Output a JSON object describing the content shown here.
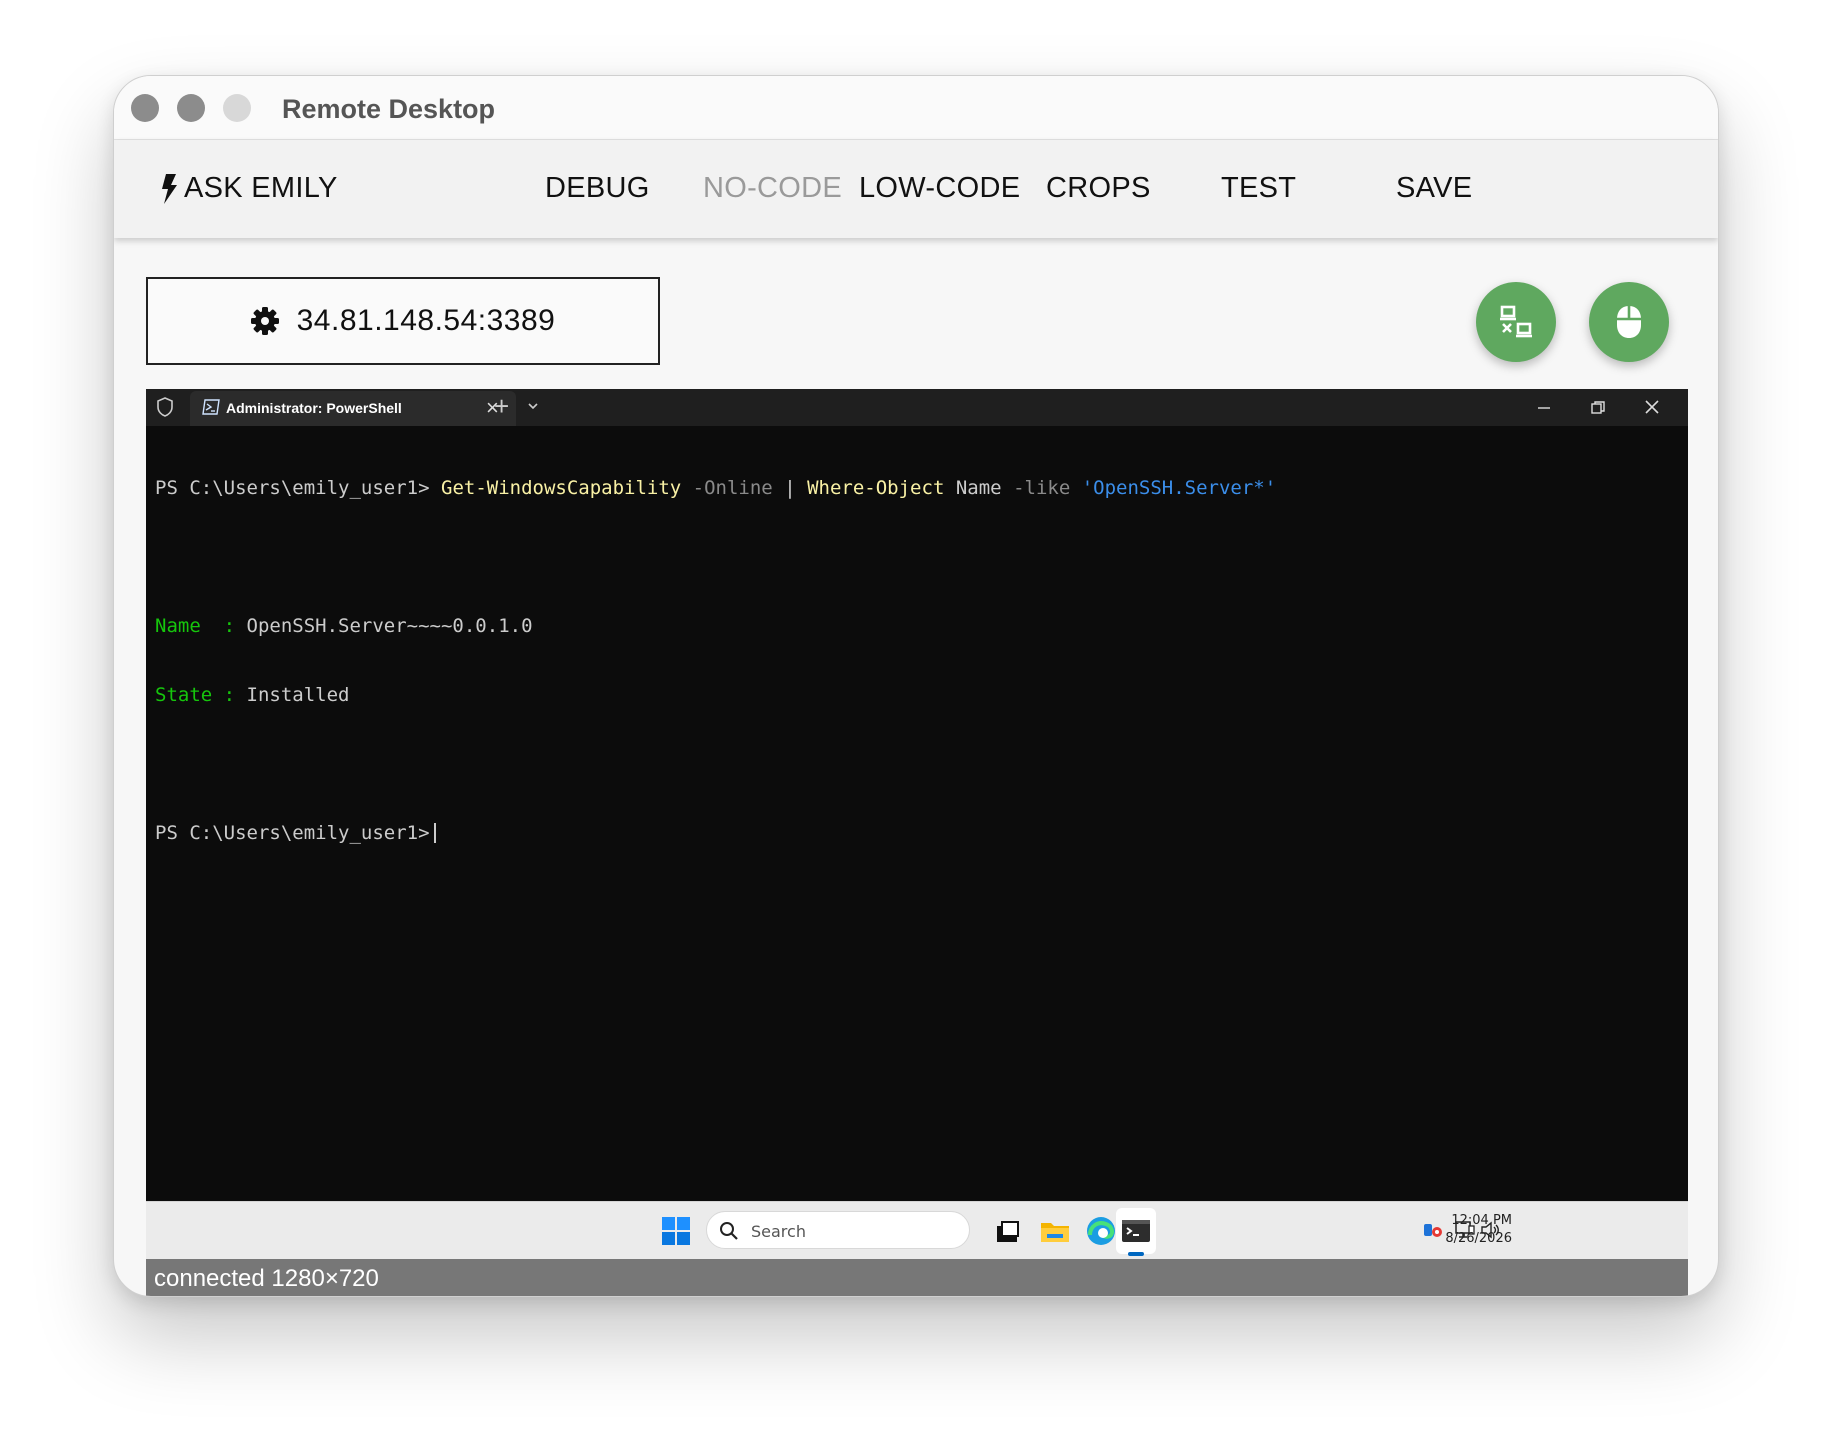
{
  "window": {
    "title": "Remote Desktop"
  },
  "toolbar": {
    "ask_label": "ASK EMILY",
    "items": [
      {
        "label": "DEBUG",
        "enabled": true
      },
      {
        "label": "NO-CODE",
        "enabled": false
      },
      {
        "label": "LOW-CODE",
        "enabled": true
      },
      {
        "label": "CROPS",
        "enabled": true
      },
      {
        "label": "TEST",
        "enabled": true
      },
      {
        "label": "SAVE",
        "enabled": true
      }
    ]
  },
  "connection": {
    "address": "34.81.148.54:3389"
  },
  "fab_color": "#5fa85f",
  "terminal": {
    "tab_title": "Administrator: PowerShell",
    "prompt": "PS C:\\Users\\emily_user1>",
    "command": {
      "cmdlet1": "Get-WindowsCapability",
      "param1": "-Online",
      "pipe": "|",
      "cmdlet2": "Where-Object",
      "arg": "Name",
      "param2": "-like",
      "string": "'OpenSSH.Server*'"
    },
    "output": [
      {
        "key": "Name ",
        "value": "OpenSSH.Server~~~~0.0.1.0"
      },
      {
        "key": "State",
        "value": "Installed"
      }
    ]
  },
  "taskbar": {
    "search_placeholder": "Search",
    "time": "12:04 PM",
    "date": "8/26/2026"
  },
  "status": {
    "text": "connected 1280×720"
  }
}
